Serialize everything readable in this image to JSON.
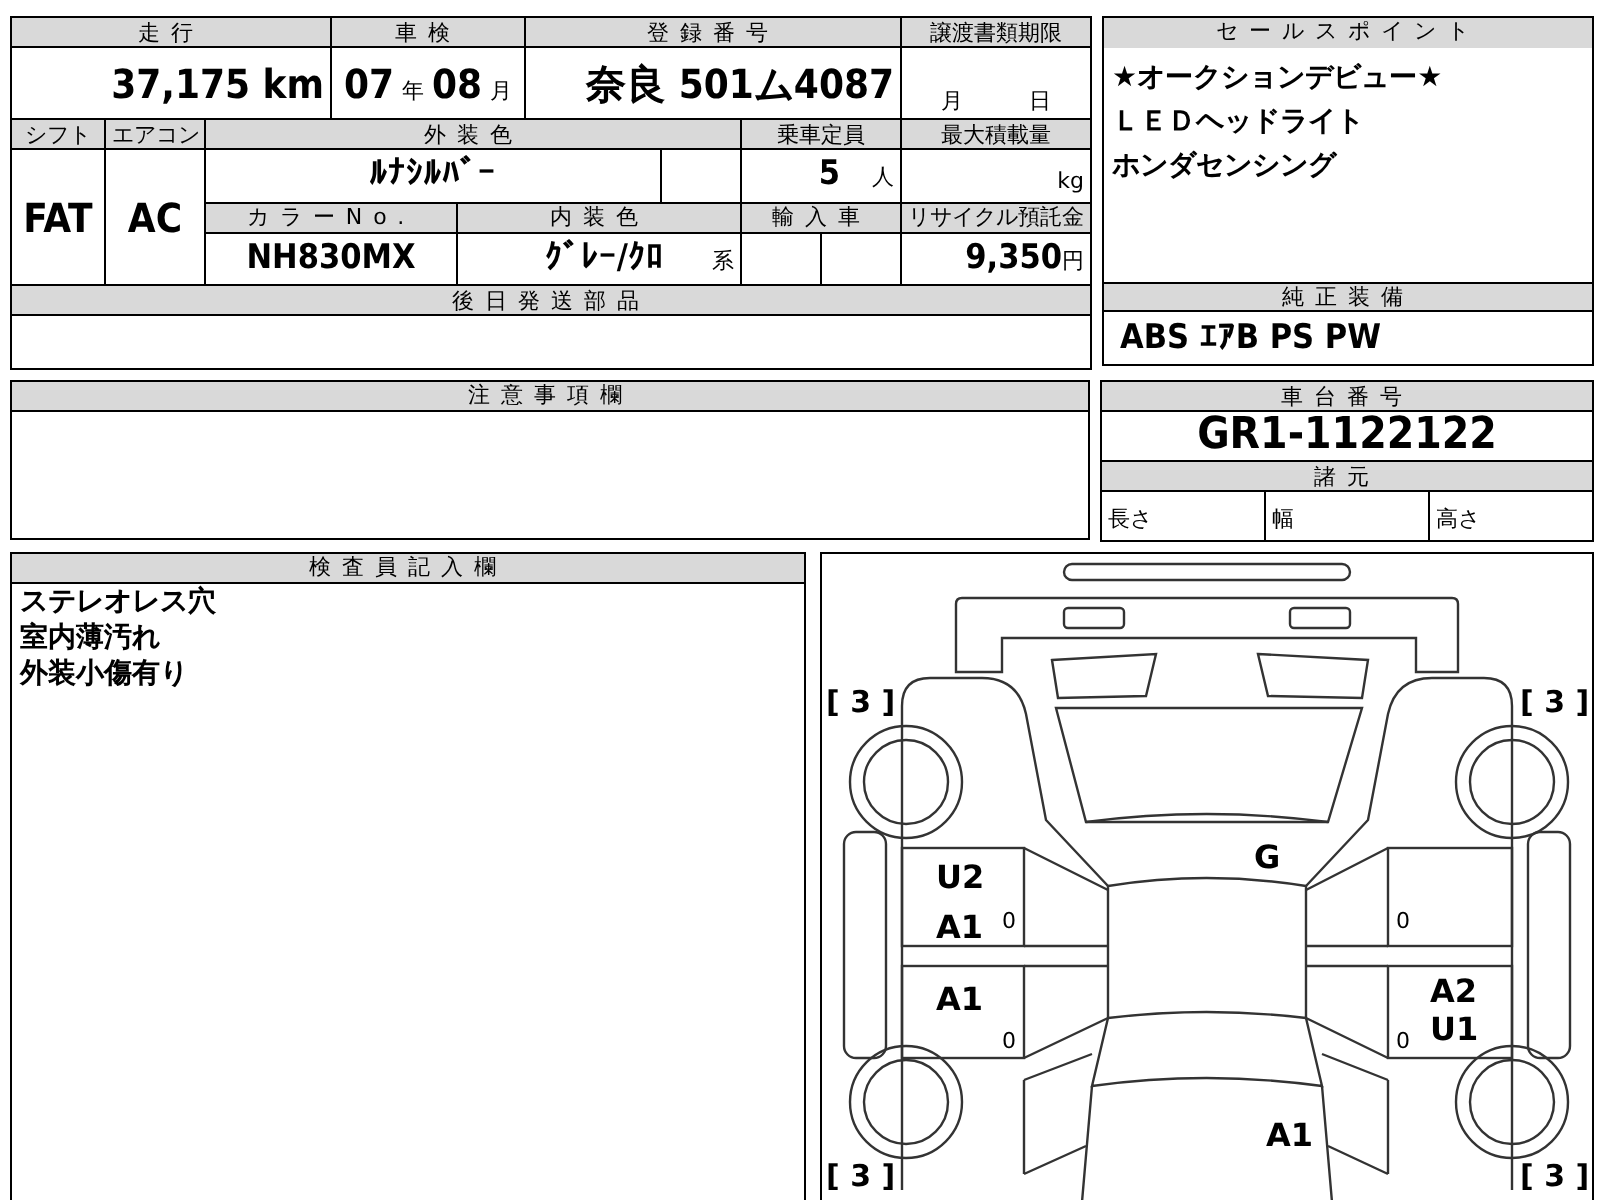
{
  "vehicle_table": {
    "mileage": {
      "label": "走行",
      "value": "37,175",
      "unit": "km"
    },
    "inspection": {
      "label": "車検",
      "year": "07",
      "year_unit": "年",
      "month": "08",
      "month_unit": "月"
    },
    "registration": {
      "label": "登録番号",
      "value": "奈良 501ム4087"
    },
    "document_deadline": {
      "label": "譲渡書類期限",
      "month_unit": "月",
      "day_unit": "日"
    },
    "shift": {
      "label": "シフト",
      "value": "FAT"
    },
    "air_conditioner": {
      "label": "エアコン",
      "value": "AC"
    },
    "exterior_color": {
      "label": "外装色",
      "value": "ﾙﾅｼﾙﾊﾞｰ"
    },
    "capacity": {
      "label": "乗車定員",
      "value": "5",
      "unit": "人"
    },
    "max_load": {
      "label": "最大積載量",
      "unit": "kg"
    },
    "color_number": {
      "label": "カラーNo.",
      "value": "NH830MX"
    },
    "interior_color": {
      "label": "内装色",
      "value": "ｸﾞﾚｰ/ｸﾛ",
      "suffix": "系"
    },
    "imported": {
      "label": "輸入車"
    },
    "recycling_fee": {
      "label": "リサイクル預託金",
      "value": "9,350",
      "unit": "円"
    },
    "parts_later": {
      "label": "後日発送部品"
    }
  },
  "sales_points": {
    "label": "セールスポイント",
    "lines": [
      "★オークションデビュー★",
      "ＬＥＤヘッドライト",
      "ホンダセンシング"
    ]
  },
  "standard_equipment": {
    "label": "純正装備",
    "value": "ABS ｴｱB PS PW"
  },
  "notes": {
    "label": "注意事項欄"
  },
  "chassis": {
    "label": "車台番号",
    "value": "GR1-1122122",
    "specs_label": "諸元",
    "specs": [
      "長さ",
      "幅",
      "高さ"
    ]
  },
  "inspector_notes": {
    "label": "検査員記入欄",
    "lines": [
      "ステレオレス穴",
      "室内薄汚れ",
      "外装小傷有り"
    ]
  },
  "diagram": {
    "tire_depths": [
      "[ 3 ]",
      "[ 3 ]",
      "[ 3 ]",
      "[ 3 ]"
    ],
    "panels": [
      {
        "kind": "roof",
        "codes": [
          "G"
        ]
      },
      {
        "kind": "left_front_door",
        "codes": [
          "U2",
          "A1"
        ],
        "mark": "0"
      },
      {
        "kind": "right_front_door",
        "mark": "0"
      },
      {
        "kind": "left_rear_door",
        "codes": [
          "A1"
        ],
        "mark": "0"
      },
      {
        "kind": "right_rear_door",
        "codes": [
          "A2",
          "U1"
        ],
        "mark": "0"
      },
      {
        "kind": "trunk",
        "codes": [
          "A1"
        ]
      }
    ]
  }
}
